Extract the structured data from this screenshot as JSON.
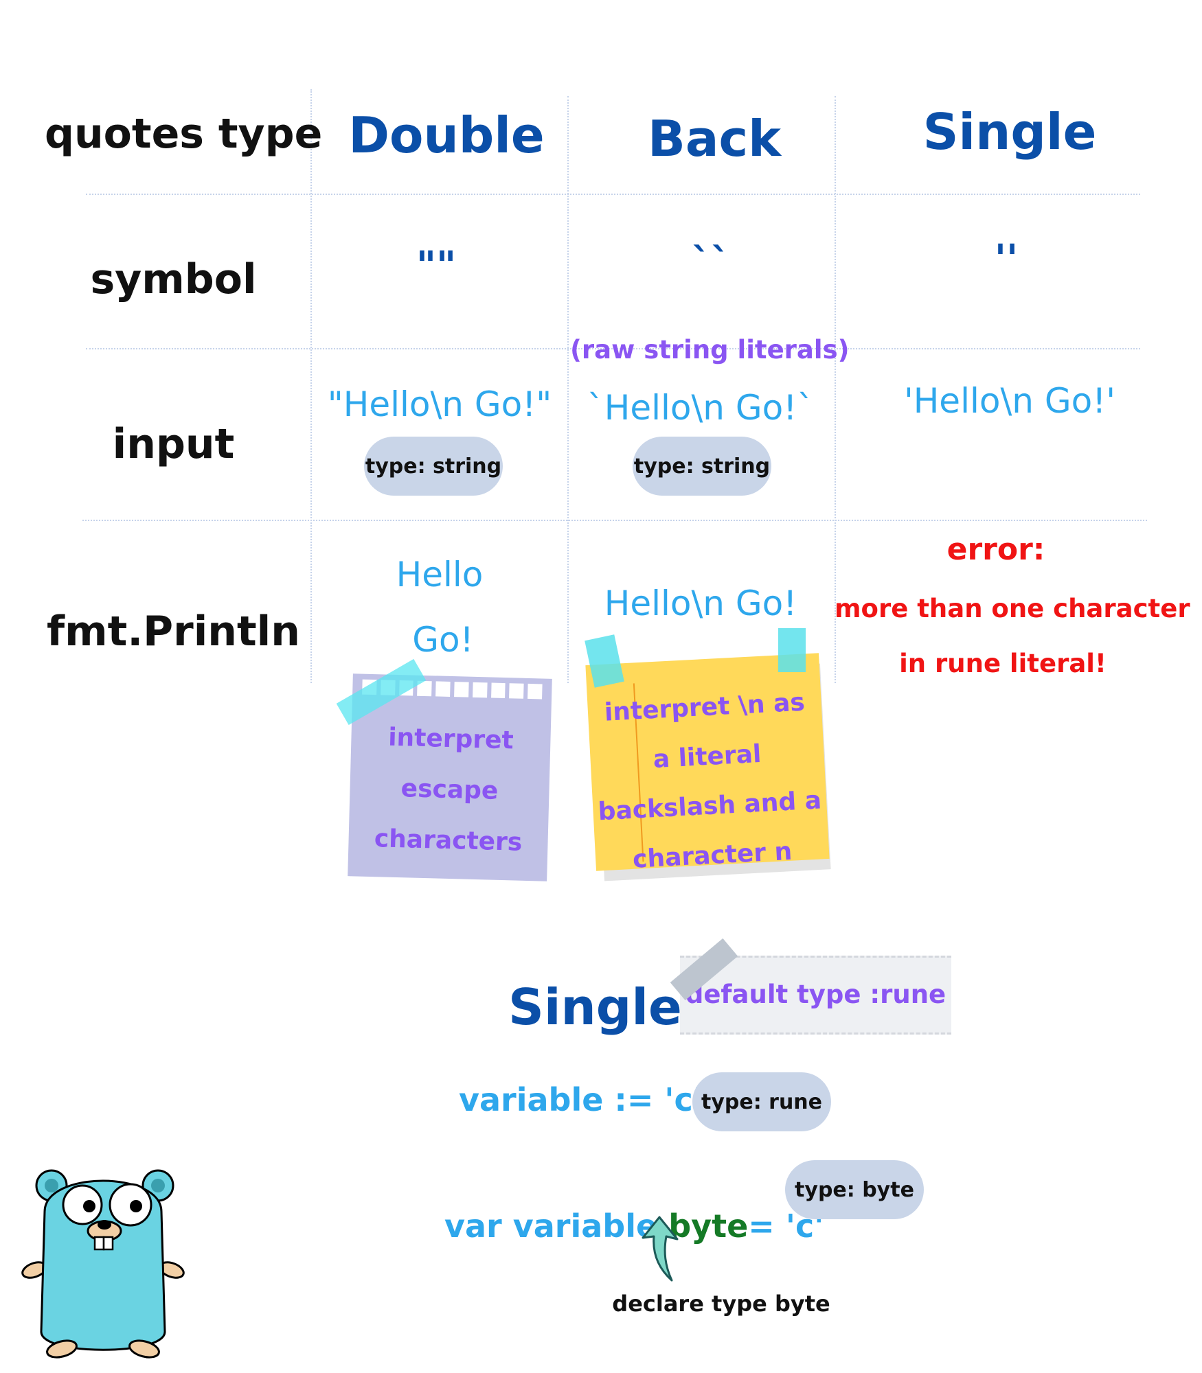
{
  "table": {
    "row_labels": {
      "quotes_type": "quotes type",
      "symbol": "symbol",
      "input": "input",
      "println": "fmt.Println"
    },
    "columns": [
      {
        "heading": "Double",
        "symbol": "\"\"",
        "input": "\"Hello\\n Go!\"",
        "input_type": "type: string",
        "output_line1": "Hello",
        "output_line2": "Go!",
        "note": [
          "interpret",
          "escape",
          "characters"
        ]
      },
      {
        "heading": "Back",
        "symbol": "``",
        "sublabel": "(raw string literals)",
        "input": "`Hello\\n Go!`",
        "input_type": "type: string",
        "output": "Hello\\n Go!",
        "note": [
          "interpret \\n as",
          "a literal",
          "backslash and a",
          "character n"
        ]
      },
      {
        "heading": "Single",
        "symbol": "''",
        "input": "'Hello\\n Go!'",
        "error_title": "error:",
        "error_line1": "more than one character",
        "error_line2": "in rune literal!"
      }
    ]
  },
  "single_section": {
    "title": "Single",
    "tape_label": "default type :rune",
    "example1": {
      "code": "variable := 'c'",
      "type": "type: rune"
    },
    "example2": {
      "code_part1": "var variable ",
      "code_highlight": "byte",
      "code_part2": "= 'c'",
      "type": "type: byte"
    },
    "arrow_label": "declare type byte"
  },
  "colors": {
    "heading_blue": "#0b4fa8",
    "literal_blue": "#2ea7ec",
    "purple": "#8a55f2",
    "error_red": "#f01414",
    "byte_green": "#157a26",
    "pill_bg": "#c9d5e8",
    "note_purple_bg": "#c0c1e6",
    "note_yellow_bg": "#ffd95a",
    "gopher_body": "#6ad3e2"
  },
  "icons": [
    "gopher-mascot-icon",
    "up-arrow-icon"
  ]
}
